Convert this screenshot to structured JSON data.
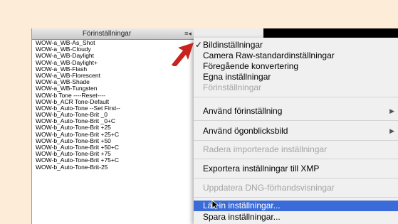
{
  "panel": {
    "title": "Förinställningar",
    "menu_button": "≡◂",
    "presets": [
      "WOW-a_WB-As_Shot",
      "WOW-a_WB-Cloudy",
      "WOW-a_WB-Daylight",
      "WOW-a_WB-Daylight+",
      "WOW-a_WB-Flash",
      "WOW-a_WB-Florescent",
      "WOW-a_WB-Shade",
      "WOW-a_WB-Tungsten",
      "WOW-b Tone ----Reset----",
      "WOW-b_ACR Tone-Default",
      "WOW-b_Auto-Tone --Set First--",
      "WOW-b_Auto-Tone-Brit _0",
      "WOW-b_Auto-Tone-Brit _0+C",
      "WOW-b_Auto-Tone-Brit +25",
      "WOW-b_Auto-Tone-Brit +25+C",
      "WOW-b_Auto-Tone-Brit +50",
      "WOW-b_Auto-Tone-Brit +50+C",
      "WOW-b_Auto-Tone-Brit +75",
      "WOW-b_Auto-Tone-Brit +75+C",
      "WOW-b_Auto-Tone-Brit-25"
    ]
  },
  "menu": {
    "check_glyph": "✓",
    "submenu_glyph": "▶",
    "items": [
      {
        "label": "Bildinställningar"
      },
      {
        "label": "Camera Raw-standardinställningar"
      },
      {
        "label": "Föregående konvertering"
      },
      {
        "label": "Egna inställningar"
      },
      {
        "label": "Förinställningar"
      },
      {
        "label": "Använd förinställning"
      },
      {
        "label": "Använd ögonblicksbild"
      },
      {
        "label": "Radera importerade inställningar"
      },
      {
        "label": "Exportera inställningar till XMP"
      },
      {
        "label": "Uppdatera DNG-förhandsvisningar"
      },
      {
        "label": "Läs in inställningar..."
      },
      {
        "label": "Spara inställningar..."
      }
    ]
  },
  "colors": {
    "background": "#fcecd8",
    "highlight": "#3a6bd8",
    "annotation_arrow": "#c8231e"
  }
}
